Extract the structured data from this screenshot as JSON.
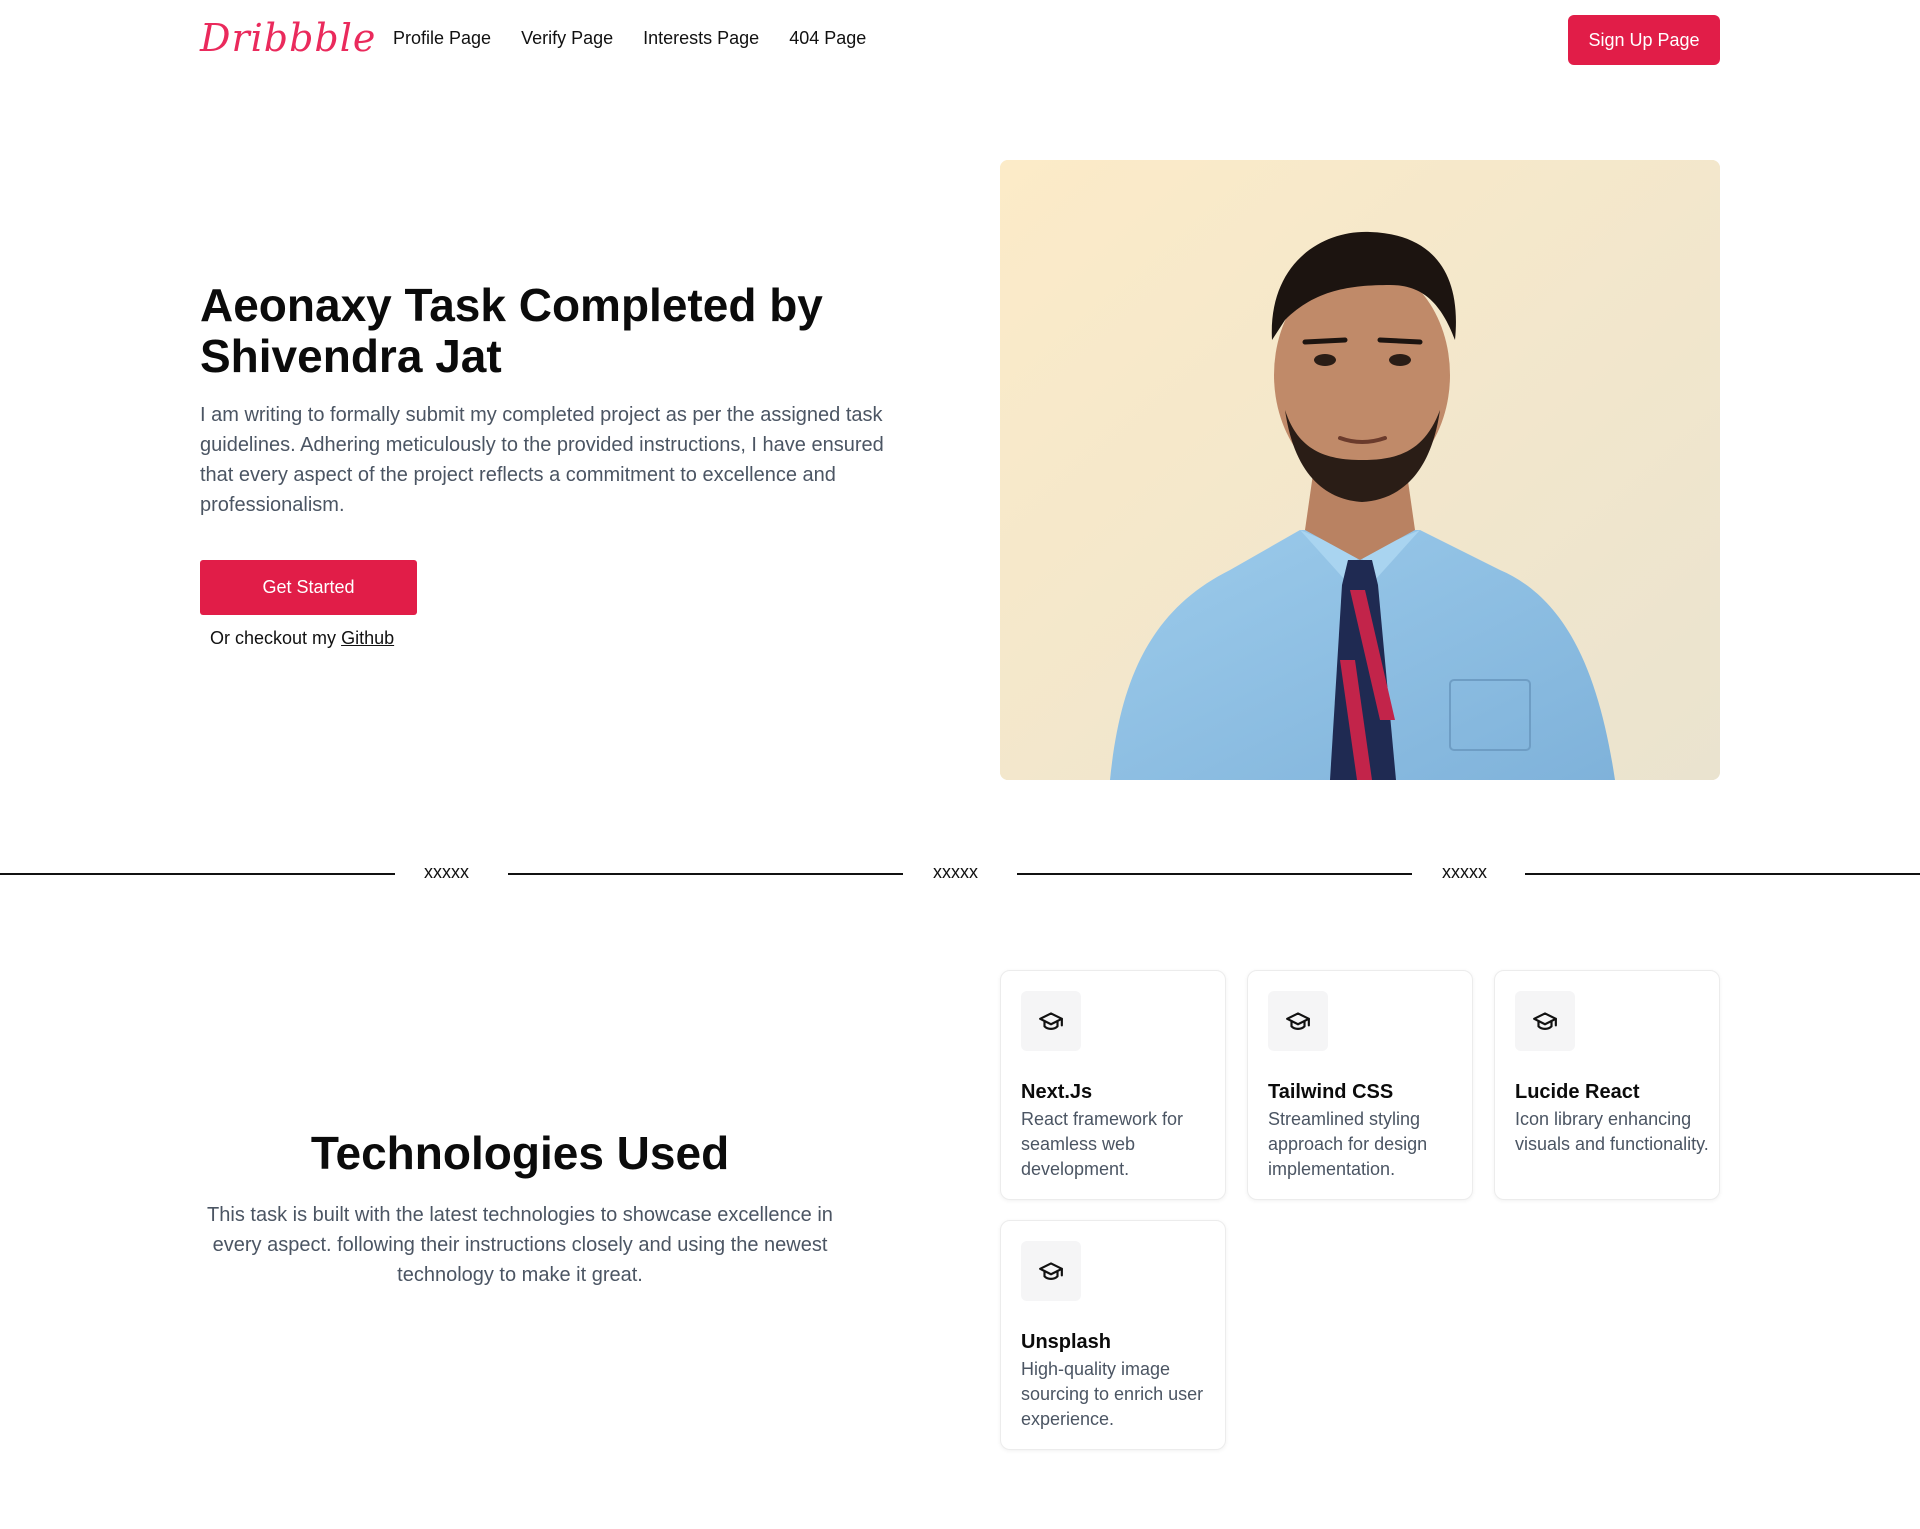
{
  "header": {
    "logo": "Dribbble",
    "nav": [
      "Profile Page",
      "Verify Page",
      "Interests Page",
      "404 Page"
    ],
    "signup_label": "Sign Up Page"
  },
  "hero": {
    "title": "Aeonaxy Task Completed by Shivendra Jat",
    "description": "I am writing to formally submit my completed project as per the assigned task guidelines. Adhering meticulously to the provided instructions, I have ensured that every aspect of the project reflects a commitment to excellence and professionalism.",
    "cta_label": "Get Started",
    "checkout_prefix": "Or checkout my",
    "checkout_link": "Github"
  },
  "divider": {
    "marks": [
      "xxxxx",
      "xxxxx",
      "xxxxx"
    ]
  },
  "tech": {
    "title": "Technologies Used",
    "description": "This task is built with the latest technologies to showcase excellence in every aspect. following their instructions closely and using the newest technology to make it great.",
    "cards": [
      {
        "icon": "graduation-cap-icon",
        "title": "Next.Js",
        "description": "React framework for seamless web development."
      },
      {
        "icon": "graduation-cap-icon",
        "title": "Tailwind CSS",
        "description": "Streamlined styling approach for design implementation."
      },
      {
        "icon": "graduation-cap-icon",
        "title": "Lucide React",
        "description": "Icon library enhancing visuals and functionality."
      },
      {
        "icon": "graduation-cap-icon",
        "title": "Unsplash",
        "description": "High-quality image sourcing to enrich user experience."
      }
    ]
  },
  "colors": {
    "brand": "#e11d48",
    "text": "#111111",
    "muted": "#4b5563"
  }
}
